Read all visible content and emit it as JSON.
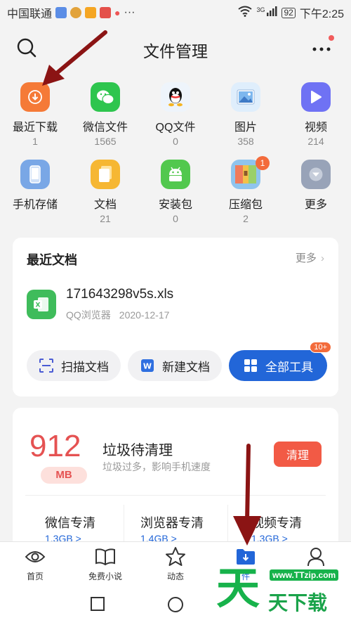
{
  "status": {
    "carrier": "中国联通",
    "signal": "3G",
    "battery": "92",
    "time": "下午2:25"
  },
  "header": {
    "title": "文件管理"
  },
  "categories": [
    {
      "label": "最近下载",
      "count": "1",
      "icon": "download-icon",
      "color": "#f57a37"
    },
    {
      "label": "微信文件",
      "count": "1565",
      "icon": "wechat-icon",
      "color": "#2ec54e"
    },
    {
      "label": "QQ文件",
      "count": "0",
      "icon": "qq-icon",
      "color": "#e8f1fb"
    },
    {
      "label": "图片",
      "count": "358",
      "icon": "image-icon",
      "color": "#dfeefc"
    },
    {
      "label": "视频",
      "count": "214",
      "icon": "video-icon",
      "color": "#6f72f4"
    },
    {
      "label": "手机存储",
      "count": "",
      "icon": "phone-storage-icon",
      "color": "#79a7e6"
    },
    {
      "label": "文档",
      "count": "21",
      "icon": "document-icon",
      "color": "#f6b733"
    },
    {
      "label": "安装包",
      "count": "0",
      "icon": "android-icon",
      "color": "#52c84e"
    },
    {
      "label": "压缩包",
      "count": "2",
      "icon": "zip-icon",
      "color": "#f07b5b",
      "badge": "1"
    },
    {
      "label": "更多",
      "count": "",
      "icon": "more-chevron-icon",
      "color": "#98a3b8"
    }
  ],
  "recent_docs": {
    "title": "最近文档",
    "more": "更多",
    "file": {
      "name": "171643298v5s.xls",
      "source": "QQ浏览器",
      "date": "2020-12-17"
    },
    "tools": {
      "scan": "扫描文档",
      "new_doc": "新建文档",
      "all_tools": "全部工具",
      "all_badge": "10+"
    }
  },
  "cleanup": {
    "amount": "912",
    "unit": "MB",
    "title": "垃圾待清理",
    "subtitle": "垃圾过多，影响手机速度",
    "button": "清理",
    "columns": [
      {
        "label": "微信专清",
        "size": "1.3GB >"
      },
      {
        "label": "浏览器专清",
        "size": "1.4GB >"
      },
      {
        "label": "视频专清",
        "size": "1.3GB >"
      }
    ]
  },
  "tabs": [
    {
      "label": "首页",
      "icon": "eye-icon"
    },
    {
      "label": "免费小说",
      "icon": "book-icon"
    },
    {
      "label": "动态",
      "icon": "star-icon"
    },
    {
      "label": "件",
      "icon": "folder-download-icon"
    },
    {
      "label": "",
      "icon": "user-icon"
    }
  ],
  "watermark": {
    "big": "天",
    "url": "www.TTzip.com",
    "text": "天下载"
  },
  "colors": {
    "accent": "#2266d8",
    "danger": "#e55252",
    "annotation": "#8b1414"
  }
}
